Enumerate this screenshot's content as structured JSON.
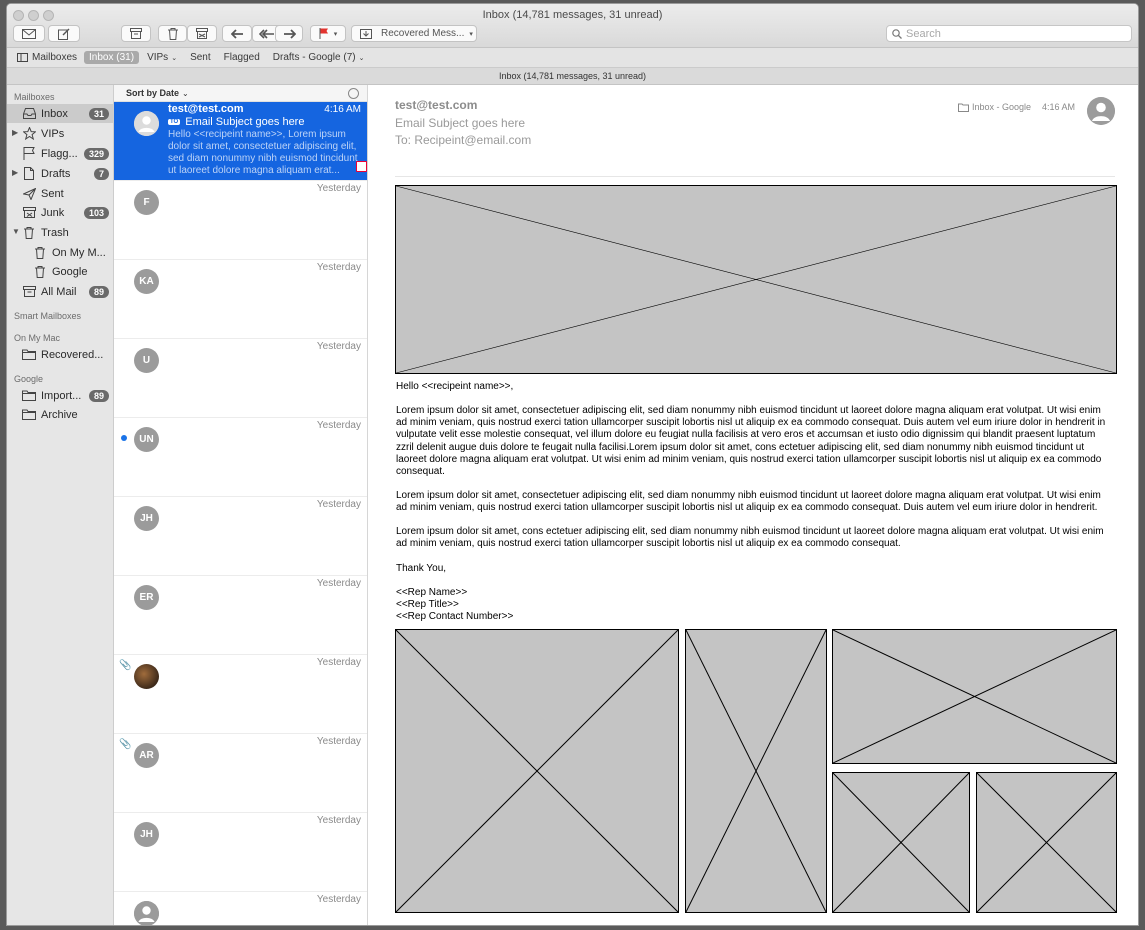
{
  "window": {
    "title": "Inbox (14,781 messages, 31 unread)"
  },
  "toolbar": {
    "move_menu_label": "Recovered Mess...",
    "search_placeholder": "Search"
  },
  "favorites": [
    {
      "label": "Mailboxes"
    },
    {
      "label": "Inbox (31)"
    },
    {
      "label": "VIPs"
    },
    {
      "label": "Sent"
    },
    {
      "label": "Flagged"
    },
    {
      "label": "Drafts - Google (7)"
    }
  ],
  "status_text": "Inbox (14,781 messages, 31 unread)",
  "sidebar": {
    "mailboxes_header": "Mailboxes",
    "items": [
      {
        "label": "Inbox",
        "badge": "31",
        "icon": "inbox-icon"
      },
      {
        "label": "VIPs",
        "badge": "",
        "icon": "star-icon"
      },
      {
        "label": "Flagg...",
        "badge": "329",
        "icon": "flag-icon"
      },
      {
        "label": "Drafts",
        "badge": "7",
        "icon": "document-icon"
      },
      {
        "label": "Sent",
        "badge": "",
        "icon": "paper-plane-icon"
      },
      {
        "label": "Junk",
        "badge": "103",
        "icon": "junk-tray-icon"
      },
      {
        "label": "Trash",
        "badge": "",
        "icon": "trash-icon"
      },
      {
        "label": "On My M...",
        "badge": "",
        "icon": "trash-icon"
      },
      {
        "label": "Google",
        "badge": "",
        "icon": "trash-icon"
      },
      {
        "label": "All Mail",
        "badge": "89",
        "icon": "archive-icon"
      }
    ],
    "smart_header": "Smart Mailboxes",
    "onmymac_header": "On My Mac",
    "onmymac_items": [
      {
        "label": "Recovered..."
      }
    ],
    "google_header": "Google",
    "google_items": [
      {
        "label": "Import...",
        "badge": "89"
      },
      {
        "label": "Archive",
        "badge": ""
      }
    ]
  },
  "message_list": {
    "sort_label": "Sort by Date",
    "messages": [
      {
        "from": "test@test.com",
        "to_tag": "TO",
        "subject": "Email Subject goes here",
        "preview": "Hello <<recipeint name>>, Lorem ipsum dolor sit amet, consectetuer adipiscing elit, sed diam nonummy nibh euismod tincidunt ut laoreet dolore magna aliquam erat...",
        "date": "4:16 AM",
        "avatar": ""
      },
      {
        "date": "Yesterday",
        "avatar": "F"
      },
      {
        "date": "Yesterday",
        "avatar": "KA"
      },
      {
        "date": "Yesterday",
        "avatar": "U"
      },
      {
        "date": "Yesterday",
        "avatar": "UN"
      },
      {
        "date": "Yesterday",
        "avatar": "JH"
      },
      {
        "date": "Yesterday",
        "avatar": "ER"
      },
      {
        "date": "Yesterday",
        "avatar": ""
      },
      {
        "date": "Yesterday",
        "avatar": "AR"
      },
      {
        "date": "Yesterday",
        "avatar": "JH"
      },
      {
        "date": "Yesterday",
        "avatar": ""
      }
    ]
  },
  "email": {
    "from": "test@test.com",
    "subject": "Email Subject goes here",
    "to": "To: Recipeint@email.com",
    "mailbox": "Inbox - Google",
    "time": "4:16 AM",
    "greeting": "Hello <<recipeint name>>,",
    "paragraph1": "Lorem ipsum dolor sit amet, consectetuer adipiscing elit, sed diam nonummy nibh euismod tincidunt ut laoreet dolore magna aliquam erat volutpat. Ut wisi enim ad minim veniam, quis nostrud exerci tation ullamcorper suscipit lobortis nisl ut aliquip ex ea commodo consequat. Duis autem vel eum iriure dolor in hendrerit in vulputate velit esse molestie consequat, vel illum dolore eu feugiat nulla facilisis at vero eros et accumsan et iusto odio dignissim qui blandit praesent luptatum zzril delenit augue duis dolore te feugait nulla facilisi.Lorem ipsum dolor sit amet, cons ectetuer adipiscing elit, sed diam nonummy nibh euismod tincidunt ut laoreet dolore magna aliquam erat volutpat. Ut wisi enim ad minim veniam, quis nostrud exerci tation ullamcorper suscipit lobortis nisl ut aliquip ex ea commodo consequat.",
    "paragraph2": "Lorem ipsum dolor sit amet, consectetuer adipiscing elit, sed diam nonummy nibh euismod tincidunt ut laoreet dolore magna aliquam erat volutpat. Ut wisi enim ad minim veniam, quis nostrud exerci tation ullamcorper suscipit lobortis nisl ut aliquip ex ea commodo consequat. Duis autem vel eum iriure dolor in hendrerit.",
    "paragraph3": "Lorem ipsum dolor sit amet, cons ectetuer adipiscing elit, sed diam nonummy nibh euismod tincidunt ut laoreet dolore magna aliquam erat volutpat. Ut wisi enim ad minim veniam, quis nostrud exerci tation ullamcorper suscipit lobortis nisl ut aliquip ex ea commodo consequat.",
    "closing": "Thank You,",
    "sig_name": "<<Rep Name>>",
    "sig_title": "<<Rep Title>>",
    "sig_contact": "<<Rep Contact Number>>"
  },
  "colors": {
    "selection": "#1565e0",
    "badge": "#6a6a6a",
    "placeholder_fill": "#c4c4c4"
  }
}
